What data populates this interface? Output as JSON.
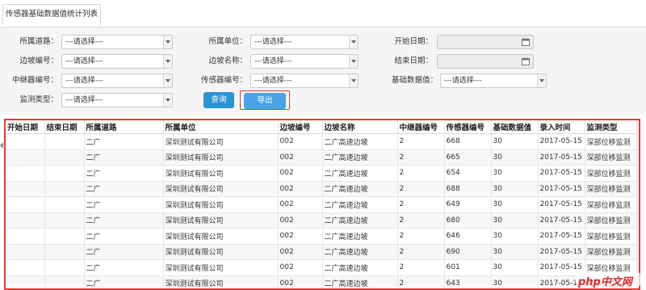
{
  "tab": {
    "label": "传感器基础数据值统计列表"
  },
  "filters": {
    "road": {
      "label": "所属道路：",
      "value": "---请选择---"
    },
    "unit": {
      "label": "所属单位：",
      "value": "---请选择---"
    },
    "start_date": {
      "label": "开始日期：",
      "value": ""
    },
    "slope_no": {
      "label": "边坡编号：",
      "value": "---请选择---"
    },
    "slope_name": {
      "label": "边坡名称：",
      "value": "---请选择---"
    },
    "end_date": {
      "label": "结束日期：",
      "value": ""
    },
    "relay_no": {
      "label": "中继器编号：",
      "value": "---请选择---"
    },
    "sensor_no": {
      "label": "传感器编号：",
      "value": "---请选择---"
    },
    "base_value": {
      "label": "基础数据值：",
      "value": "---请选择---"
    },
    "monitor_type": {
      "label": "监测类型：",
      "value": "---请选择---"
    }
  },
  "buttons": {
    "query": "查询",
    "export": "导出"
  },
  "table": {
    "headers": [
      "开始日期",
      "结束日期",
      "所属道路",
      "所属单位",
      "边坡编号",
      "边坡名称",
      "中继器编号",
      "传感器编号",
      "基础数据值",
      "录入时间",
      "监测类型"
    ],
    "rows": [
      [
        "",
        "",
        "二广",
        "深圳测试有限公司",
        "002",
        "二广高速边坡",
        "2",
        "668",
        "30",
        "2017-05-15",
        "深部位移监测"
      ],
      [
        "",
        "",
        "二广",
        "深圳测试有限公司",
        "002",
        "二广高速边坡",
        "2",
        "665",
        "30",
        "2017-05-15",
        "深部位移监测"
      ],
      [
        "",
        "",
        "二广",
        "深圳测试有限公司",
        "002",
        "二广高速边坡",
        "2",
        "654",
        "30",
        "2017-05-15",
        "深部位移监测"
      ],
      [
        "",
        "",
        "二广",
        "深圳测试有限公司",
        "002",
        "二广高速边坡",
        "2",
        "688",
        "30",
        "2017-05-15",
        "深部位移监测"
      ],
      [
        "",
        "",
        "二广",
        "深圳测试有限公司",
        "002",
        "二广高速边坡",
        "2",
        "649",
        "30",
        "2017-05-15",
        "深部位移监测"
      ],
      [
        "",
        "",
        "二广",
        "深圳测试有限公司",
        "002",
        "二广高速边坡",
        "2",
        "680",
        "30",
        "2017-05-15",
        "深部位移监测"
      ],
      [
        "",
        "",
        "二广",
        "深圳测试有限公司",
        "002",
        "二广高速边坡",
        "2",
        "646",
        "30",
        "2017-05-15",
        "深部位移监测"
      ],
      [
        "",
        "",
        "二广",
        "深圳测试有限公司",
        "002",
        "二广高速边坡",
        "2",
        "690",
        "30",
        "2017-05-15",
        "深部位移监测"
      ],
      [
        "",
        "",
        "二广",
        "深圳测试有限公司",
        "002",
        "二广高速边坡",
        "2",
        "601",
        "30",
        "2017-05-15",
        "深部位移监测"
      ],
      [
        "",
        "",
        "二广",
        "深圳测试有限公司",
        "002",
        "二广高速边坡",
        "2",
        "643",
        "30",
        "2017-05-15",
        "深部位移监测"
      ]
    ]
  },
  "watermark": {
    "text": "php中文网"
  },
  "colors": {
    "button_blue": "#2a95d6",
    "highlight_red": "#e53935",
    "watermark_red": "#d9302c"
  }
}
